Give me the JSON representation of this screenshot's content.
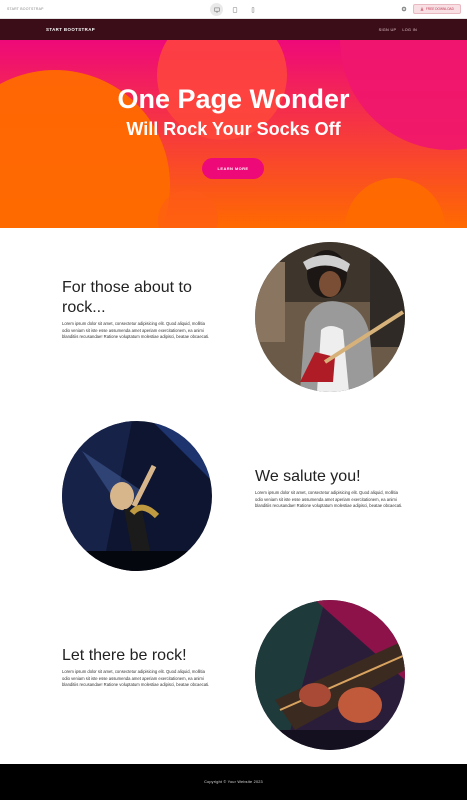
{
  "toolbar": {
    "site_label": "START BOOTSTRAP",
    "devices": [
      "desktop",
      "tablet",
      "mobile"
    ],
    "download_label": "FREE DOWNLOAD"
  },
  "nav": {
    "brand": "START BOOTSTRAP",
    "links": [
      "SIGN UP",
      "LOG IN"
    ]
  },
  "hero": {
    "title": "One Page Wonder",
    "subtitle": "Will Rock Your Socks Off",
    "cta": "LEARN MORE"
  },
  "sections": [
    {
      "title": "For those about to rock...",
      "text": "Lorem ipsum dolor sit amet, consectetur adipisicing elit. Quod aliquid, mollitia odio veniam sit iste esse assumenda amet aperiam exercitationem, ea animi blanditiis recusandae! Ratione voluptatum molestiae adipisci, beatae obcaecati."
    },
    {
      "title": "We salute you!",
      "text": "Lorem ipsum dolor sit amet, consectetur adipisicing elit. Quod aliquid, mollitia odio veniam sit iste esse assumenda amet aperiam exercitationem, ea animi blanditiis recusandae! Ratione voluptatum molestiae adipisci, beatae obcaecati."
    },
    {
      "title": "Let there be rock!",
      "text": "Lorem ipsum dolor sit amet, consectetur adipisicing elit. Quod aliquid, mollitia odio veniam sit iste esse assumenda amet aperiam exercitationem, ea animi blanditiis recusandae! Ratione voluptatum molestiae adipisci, beatae obcaecati."
    }
  ],
  "footer": {
    "copyright": "Copyright © Your Website 2023"
  },
  "colors": {
    "nav_bg": "#3a0d18",
    "hero_top": "#ee0979",
    "hero_bottom": "#ff6a00",
    "cta_bg": "#ee0979",
    "footer_bg": "#000000"
  }
}
